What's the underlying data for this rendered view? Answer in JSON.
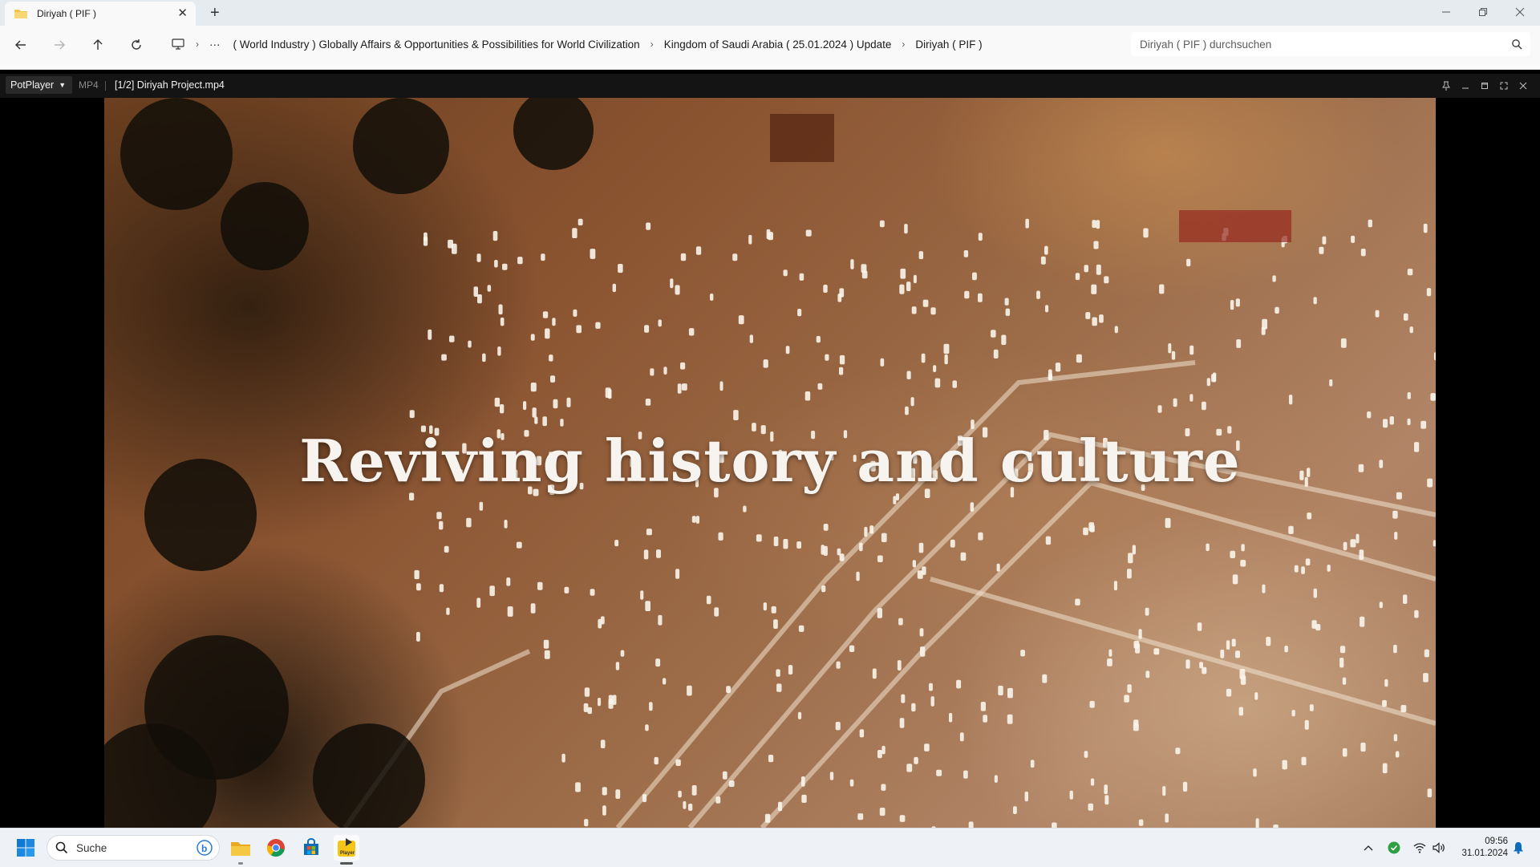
{
  "explorer": {
    "tab_title": "Diriyah ( PIF )",
    "tab_close": "✕",
    "new_tab": "+",
    "breadcrumbs": [
      "( World Industry ) Globally Affairs & Opportunities & Possibilities for World Civilization",
      "Kingdom of Saudi Arabia ( 25.01.2024 ) Update",
      "Diriyah ( PIF )"
    ],
    "breadcrumb_more": "···",
    "search_placeholder": "Diriyah ( PIF ) durchsuchen"
  },
  "player": {
    "menu_label": "PotPlayer",
    "format": "MP4",
    "file_title": "[1/2] Diriyah Project.mp4",
    "caption": "Reviving history and culture"
  },
  "taskbar": {
    "search_label": "Suche",
    "time": "09:56",
    "date": "31.01.2024",
    "pinned_icons": [
      "windows-start-icon",
      "file-explorer-icon",
      "chrome-icon",
      "microsoft-store-icon",
      "potplayer-icon"
    ],
    "tray_icons": [
      "chevron-up-icon",
      "security-shield-icon",
      "wifi-icon",
      "speaker-icon",
      "notification-bell-icon"
    ]
  },
  "colors": {
    "explorer_bg": "#f9f9f9",
    "tabstrip_bg": "#e6ebf0",
    "player_bar_bg": "#141414",
    "taskbar_bg": "#eef1f5",
    "accent": "#0067c0"
  }
}
